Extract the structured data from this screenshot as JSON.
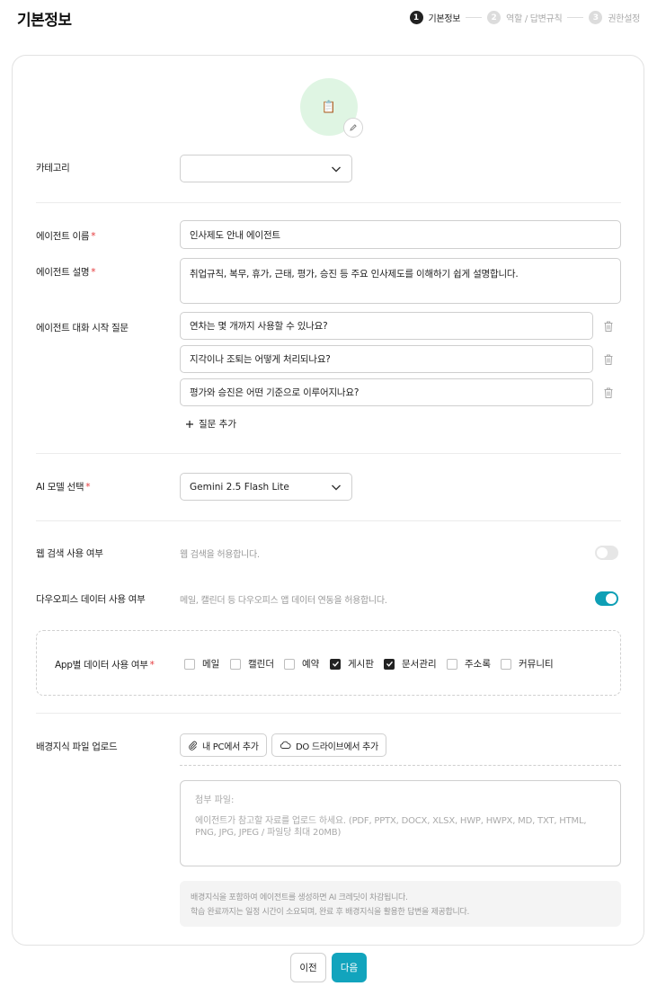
{
  "header": {
    "title": "기본정보",
    "steps": [
      {
        "num": "1",
        "label": "기본정보"
      },
      {
        "num": "2",
        "label": "역할 / 답변규칙"
      },
      {
        "num": "3",
        "label": "권한설정"
      }
    ],
    "active_step": 1
  },
  "form": {
    "avatar_emoji": "📋",
    "category": {
      "label": "카테고리",
      "value": ""
    },
    "agent_name": {
      "label": "에이전트 이름",
      "required": "*",
      "value": "인사제도 안내 에이전트"
    },
    "agent_description": {
      "label": "에이전트 설명",
      "required": "*",
      "value": "취업규칙, 복무, 휴가, 근태, 평가, 승진 등 주요 인사제도를 이해하기 쉽게 설명합니다."
    },
    "starter_questions": {
      "label": "에이전트 대화 시작 질문",
      "items": [
        "연차는 몇 개까지 사용할 수 있나요?",
        "지각이나 조퇴는 어떻게 처리되나요?",
        "평가와 승진은 어떤 기준으로 이루어지나요?"
      ],
      "add_label": "질문 추가"
    },
    "ai_model": {
      "label": "AI 모델 선택",
      "required": "*",
      "value": "Gemini 2.5 Flash Lite"
    },
    "web_search": {
      "label": "웹 검색 사용 여부",
      "hint": "웹 검색을 허용합니다.",
      "enabled": false
    },
    "daou_office": {
      "label": "다우오피스 데이터 사용 여부",
      "hint": "메일, 캘린더 등 다우오피스 앱 데이터 연동을 허용합니다.",
      "enabled": true
    },
    "app_data": {
      "label": "App별 데이터 사용 여부",
      "required": "*",
      "apps": [
        {
          "label": "메일",
          "checked": false
        },
        {
          "label": "캘린더",
          "checked": false
        },
        {
          "label": "예약",
          "checked": false
        },
        {
          "label": "게시판",
          "checked": true
        },
        {
          "label": "문서관리",
          "checked": true
        },
        {
          "label": "주소록",
          "checked": false
        },
        {
          "label": "커뮤니티",
          "checked": false
        }
      ]
    },
    "knowledge_upload": {
      "label": "배경지식 파일 업로드",
      "add_pc_label": "내 PC에서 추가",
      "add_drive_label": "DO 드라이브에서 추가",
      "attach_title": "첨부 파일:",
      "attach_desc": "에이전트가 참고할 자료를 업로드 하세요. (PDF, PPTX, DOCX, XLSX, HWP, HWPX, MD, TXT, HTML, PNG, JPG, JPEG / 파일당 최대 20MB)",
      "notice_line1": "배경지식을 포함하여 에이전트를 생성하면 AI 크레딧이 차감됩니다.",
      "notice_line2": "학습 완료까지는 일정 시간이 소요되며, 완료 후 배경지식을 활용한 답변을 제공합니다."
    }
  },
  "footer": {
    "prev_label": "이전",
    "next_label": "다음"
  },
  "colors": {
    "accent": "#12a4bd",
    "required": "#e5383b",
    "avatar_bg": "#dff5e3"
  }
}
